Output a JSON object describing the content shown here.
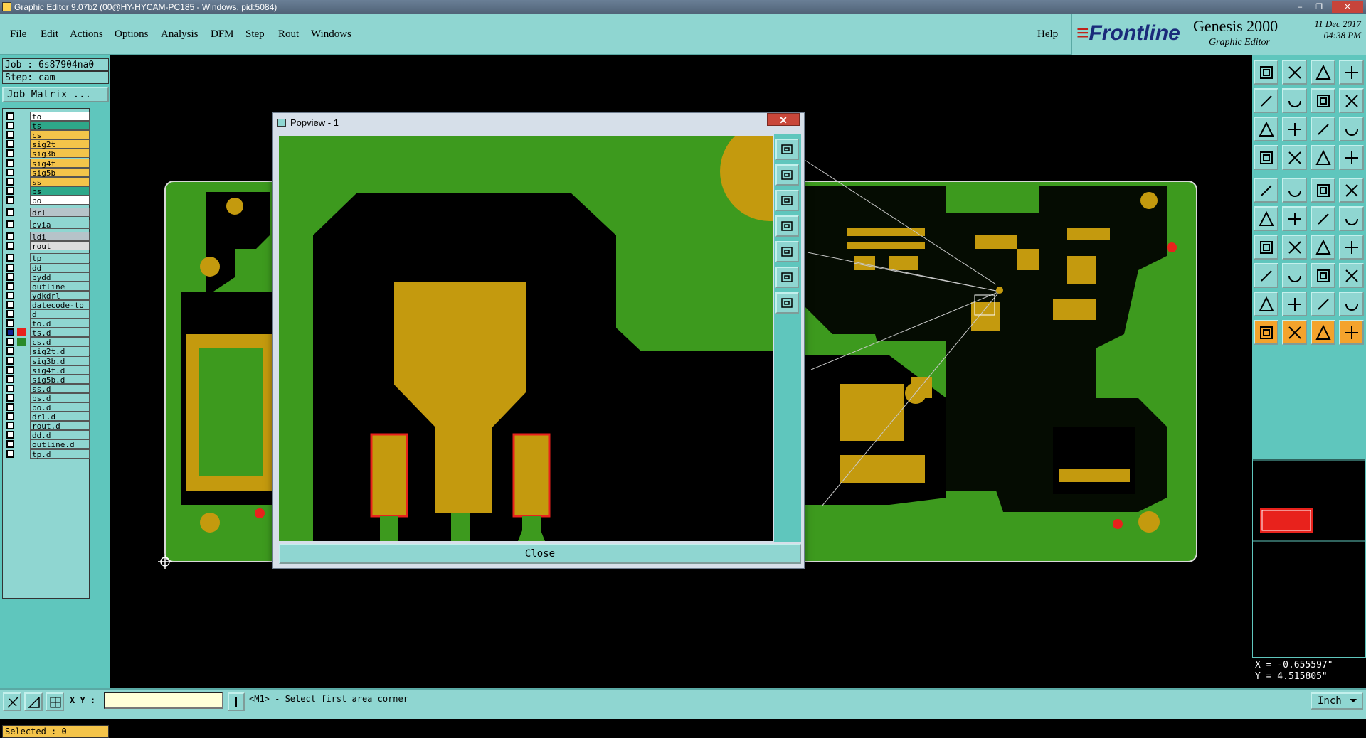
{
  "window": {
    "title": "Graphic Editor 9.07b2 (00@HY-HYCAM-PC185 - Windows, pid:5084)",
    "minimize": "–",
    "restore": "❐",
    "close": "✕"
  },
  "menu": {
    "items": [
      "File",
      "Edit",
      "Actions",
      "Options",
      "Analysis",
      "DFM",
      "Step",
      "Rout",
      "Windows"
    ],
    "help": "Help"
  },
  "brand": {
    "logo": "Frontline",
    "product": "Genesis 2000",
    "subtitle": "Graphic Editor",
    "date": "11 Dec 2017",
    "time": "04:38 PM"
  },
  "job": {
    "job_label": "Job : 6s87904na0",
    "step_label": "Step: cam",
    "matrix_button": "Job Matrix ..."
  },
  "layers": [
    {
      "name": "to",
      "color": "#ffffff"
    },
    {
      "name": "ts",
      "color": "#2ea88a"
    },
    {
      "name": "cs",
      "color": "#f4c44a"
    },
    {
      "name": "sig2t",
      "color": "#f4c44a"
    },
    {
      "name": "sig3b",
      "color": "#f4c44a"
    },
    {
      "name": "sig4t",
      "color": "#f4c44a"
    },
    {
      "name": "sig5b",
      "color": "#f4c44a"
    },
    {
      "name": "ss",
      "color": "#f4c44a"
    },
    {
      "name": "bs",
      "color": "#2ea88a"
    },
    {
      "name": "bo",
      "color": "#ffffff"
    },
    {
      "name": "drl",
      "color": "#b6c3c9"
    },
    {
      "name": "cvia",
      "color": "#8fd6d1"
    },
    {
      "name": "ldi",
      "color": "#b6c3c9"
    },
    {
      "name": "rout",
      "color": "#dcdcdc"
    },
    {
      "name": "tp",
      "color": "#8fd6d1"
    },
    {
      "name": "dd",
      "color": "#8fd6d1"
    },
    {
      "name": "bydd",
      "color": "#8fd6d1"
    },
    {
      "name": "outline",
      "color": "#8fd6d1"
    },
    {
      "name": "ydkdrl",
      "color": "#8fd6d1"
    },
    {
      "name": "datecode-to",
      "color": "#8fd6d1"
    },
    {
      "name": "d",
      "color": "#8fd6d1"
    },
    {
      "name": "to.d",
      "color": "#8fd6d1"
    },
    {
      "name": "ts.d",
      "color": "#8fd6d1"
    },
    {
      "name": "cs.d",
      "color": "#8fd6d1"
    },
    {
      "name": "sig2t.d",
      "color": "#8fd6d1"
    },
    {
      "name": "sig3b.d",
      "color": "#8fd6d1"
    },
    {
      "name": "sig4t.d",
      "color": "#8fd6d1"
    },
    {
      "name": "sig5b.d",
      "color": "#8fd6d1"
    },
    {
      "name": "ss.d",
      "color": "#8fd6d1"
    },
    {
      "name": "bs.d",
      "color": "#8fd6d1"
    },
    {
      "name": "bo.d",
      "color": "#8fd6d1"
    },
    {
      "name": "drl.d",
      "color": "#8fd6d1"
    },
    {
      "name": "rout.d",
      "color": "#8fd6d1"
    },
    {
      "name": "dd.d",
      "color": "#8fd6d1"
    },
    {
      "name": "outline.d",
      "color": "#8fd6d1"
    },
    {
      "name": "tp.d",
      "color": "#8fd6d1"
    }
  ],
  "selected_label": "Selected : 0",
  "popview": {
    "title": "Popview - 1",
    "close_button": "Close"
  },
  "status": {
    "xy_label": "X Y :",
    "xy_value": "",
    "prompt": "<M1> - Select first area corner",
    "units": "Inch"
  },
  "coords": {
    "x": "X = -0.655597\"",
    "y": "Y = 4.515805\""
  },
  "colors": {
    "panel": "#8fd6d1",
    "panel_dark": "#5fc6bd",
    "board_green": "#3d9a1e",
    "copper": "#c49a0e",
    "selected_red": "#e8221c"
  }
}
